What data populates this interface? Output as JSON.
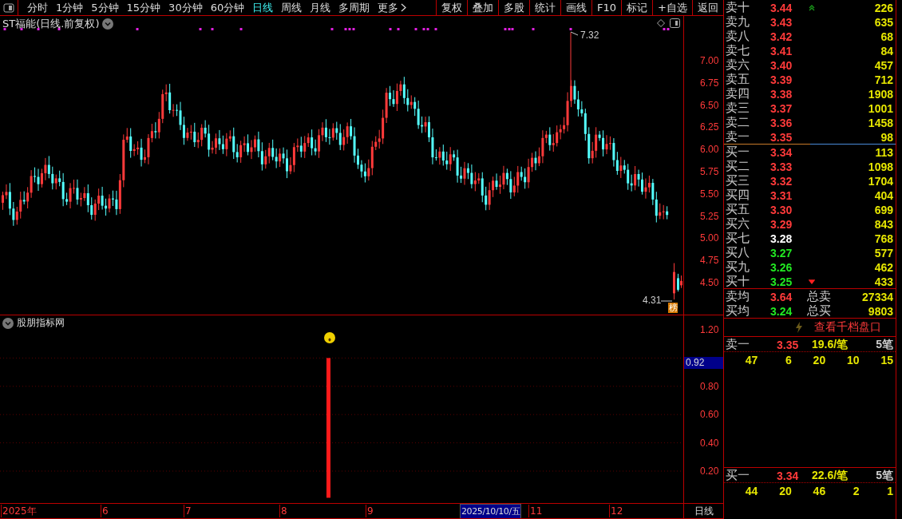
{
  "toolbar": {
    "periods": [
      {
        "label": "分时",
        "selected": false
      },
      {
        "label": "1分钟",
        "selected": false
      },
      {
        "label": "5分钟",
        "selected": false
      },
      {
        "label": "15分钟",
        "selected": false
      },
      {
        "label": "30分钟",
        "selected": false
      },
      {
        "label": "60分钟",
        "selected": false
      },
      {
        "label": "日线",
        "selected": true
      },
      {
        "label": "周线",
        "selected": false
      },
      {
        "label": "月线",
        "selected": false
      },
      {
        "label": "多周期",
        "selected": false
      }
    ],
    "more": "更多",
    "buttons": [
      "复权",
      "叠加",
      "多股",
      "统计",
      "画线",
      "F10",
      "标记",
      "+自选",
      "返回"
    ]
  },
  "price_chart": {
    "title": "ST福能(日线.前复权)",
    "y_ticks": [
      "7.00",
      "6.75",
      "6.50",
      "6.25",
      "6.00",
      "5.75",
      "5.50",
      "5.25",
      "5.00",
      "4.75",
      "4.50"
    ],
    "high_label": "7.32",
    "low_label": "4.31",
    "badge": "榜"
  },
  "indicator": {
    "title": "股朋指标网",
    "y_ticks": [
      "1.20",
      "0.80",
      "0.60",
      "0.40",
      "0.20"
    ],
    "current_value": "0.92"
  },
  "time_axis": {
    "labels": [
      "2025年",
      "6",
      "7",
      "8",
      "9",
      "11",
      "12"
    ],
    "cursor_date": "2025/10/10/五",
    "period": "日线"
  },
  "order_book": {
    "asks": [
      {
        "kind": "limit_up",
        "label": "卖十",
        "price": "3.44",
        "volume": "226",
        "color": "#ff3a3a"
      },
      {
        "kind": "plain",
        "label": "卖九",
        "price": "3.43",
        "volume": "635",
        "color": "#ff3a3a"
      },
      {
        "kind": "plain",
        "label": "卖八",
        "price": "3.42",
        "volume": "68",
        "color": "#ff3a3a"
      },
      {
        "kind": "plain",
        "label": "卖七",
        "price": "3.41",
        "volume": "84",
        "color": "#ff3a3a"
      },
      {
        "kind": "plain",
        "label": "卖六",
        "price": "3.40",
        "volume": "457",
        "color": "#ff3a3a"
      },
      {
        "kind": "plain",
        "label": "卖五",
        "price": "3.39",
        "volume": "712",
        "color": "#ff3a3a"
      },
      {
        "kind": "plain",
        "label": "卖四",
        "price": "3.38",
        "volume": "1908",
        "color": "#ff3a3a"
      },
      {
        "kind": "plain",
        "label": "卖三",
        "price": "3.37",
        "volume": "1001",
        "color": "#ff3a3a"
      },
      {
        "kind": "plain",
        "label": "卖二",
        "price": "3.36",
        "volume": "1458",
        "color": "#ff3a3a"
      },
      {
        "kind": "plain",
        "label": "卖一",
        "price": "3.35",
        "volume": "98",
        "color": "#ff3a3a"
      }
    ],
    "bids": [
      {
        "kind": "plain",
        "label": "买一",
        "price": "3.34",
        "volume": "113",
        "color": "#ff3a3a"
      },
      {
        "kind": "plain",
        "label": "买二",
        "price": "3.33",
        "volume": "1098",
        "color": "#ff3a3a"
      },
      {
        "kind": "plain",
        "label": "买三",
        "price": "3.32",
        "volume": "1704",
        "color": "#ff3a3a"
      },
      {
        "kind": "plain",
        "label": "买四",
        "price": "3.31",
        "volume": "404",
        "color": "#ff3a3a"
      },
      {
        "kind": "plain",
        "label": "买五",
        "price": "3.30",
        "volume": "699",
        "color": "#ff3a3a"
      },
      {
        "kind": "plain",
        "label": "买六",
        "price": "3.29",
        "volume": "843",
        "color": "#ff3a3a"
      },
      {
        "kind": "plain",
        "label": "买七",
        "price": "3.28",
        "volume": "768",
        "color": "#ffffff"
      },
      {
        "kind": "plain",
        "label": "买八",
        "price": "3.27",
        "volume": "577",
        "color": "#22e822"
      },
      {
        "kind": "plain",
        "label": "买九",
        "price": "3.26",
        "volume": "462",
        "color": "#22e822"
      },
      {
        "kind": "limit_down",
        "label": "买十",
        "price": "3.25",
        "volume": "433",
        "color": "#22e822"
      }
    ],
    "averages": [
      {
        "label": "卖均",
        "price": "3.64",
        "color": "#ff3a3a",
        "total_label": "总卖",
        "total": "27334"
      },
      {
        "label": "买均",
        "price": "3.24",
        "color": "#22e822",
        "total_label": "总买",
        "total": "9803"
      }
    ],
    "depth_link": "查看千档盘口",
    "queues": [
      {
        "label": "卖一",
        "price": "3.35",
        "per_order": "19.6/笔",
        "orders": "5笔",
        "sizes": [
          "47",
          "6",
          "20",
          "10",
          "15"
        ]
      },
      {
        "label": "买一",
        "price": "3.34",
        "per_order": "22.6/笔",
        "orders": "5笔",
        "sizes": [
          "44",
          "20",
          "46",
          "2",
          "1"
        ]
      }
    ]
  }
}
